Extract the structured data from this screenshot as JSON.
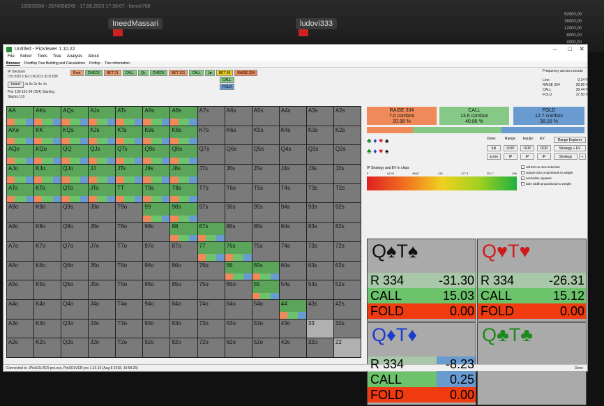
{
  "poker": {
    "topline": "1000/2000 - 2874358249 - 17.08.2020 17:30:07 - bench788",
    "players": [
      "IneedMassari",
      "ludovi333"
    ],
    "side_stacks": [
      "52000,00",
      "16000,00",
      "12000,00",
      "8000,00",
      "4000,00"
    ]
  },
  "window": {
    "title": "Untitled - PioViewer 1.10.22",
    "min": "–",
    "max": "□",
    "close": "✕"
  },
  "menu": [
    "File",
    "Solver",
    "Tools",
    "Tree",
    "Analysis",
    "About"
  ],
  "tabs": [
    "Browser",
    "Postflop Tree Building and Calculations",
    "Preflop",
    "Tree information"
  ],
  "left_info": {
    "heading": "IP Decision",
    "line1": "r:0:c:b21:c:Gc:c:b101:c:Jc:b:189",
    "board_btn": "board",
    "board_cards": "Js  6c  2s  4c  Jo",
    "pot": "Pot: 109 101 64 (354) Starting Stacks:110"
  },
  "actions": [
    {
      "label": "Root",
      "color": "#f0a070"
    },
    {
      "label": "CHECK",
      "color": "#86c986"
    },
    {
      "label": "BET 21",
      "color": "#f0a070"
    },
    {
      "label": "CALL",
      "color": "#86c986"
    },
    {
      "label": "Qc",
      "color": "#86c986"
    },
    {
      "label": "CHECK",
      "color": "#86c986"
    },
    {
      "label": "BET 101",
      "color": "#f0a070"
    },
    {
      "label": "CALL",
      "color": "#86c986"
    },
    {
      "label": "J♣",
      "color": "#86c986"
    },
    {
      "label": "BET 88",
      "color": "#f0d020"
    },
    {
      "label": "RAISE 334",
      "color": "#f08a5a"
    }
  ],
  "actions_sub": [
    "CALL",
    "FOLD"
  ],
  "freq": {
    "title": "Frequency across runouts",
    "rows": [
      [
        "Line:",
        "0.14 %"
      ],
      [
        "RAISE 334",
        "28.86 %"
      ],
      [
        "CALL",
        "38.44 %"
      ],
      [
        "FOLD",
        "37.50 %"
      ]
    ]
  },
  "grid": [
    [
      "AA",
      "AKs",
      "AQs",
      "AJs",
      "ATs",
      "A9s",
      "A8s",
      "A7s",
      "A6s",
      "A5s",
      "A4s",
      "A3s",
      "A2s"
    ],
    [
      "AKo",
      "KK",
      "KQs",
      "KJs",
      "KTs",
      "K9s",
      "K8s",
      "K7s",
      "K6s",
      "K5s",
      "K4s",
      "K3s",
      "K2s"
    ],
    [
      "AQo",
      "KQo",
      "QQ",
      "QJs",
      "QTs",
      "Q9s",
      "Q8s",
      "Q7s",
      "Q6s",
      "Q5s",
      "Q4s",
      "Q3s",
      "Q2s"
    ],
    [
      "AJo",
      "KJo",
      "QJo",
      "JJ",
      "JTs",
      "J9s",
      "J8s",
      "J7s",
      "J6s",
      "J5s",
      "J4s",
      "J3s",
      "J2s"
    ],
    [
      "ATo",
      "KTo",
      "QTo",
      "JTo",
      "TT",
      "T9s",
      "T8s",
      "T7s",
      "T6s",
      "T5s",
      "T4s",
      "T3s",
      "T2s"
    ],
    [
      "A9o",
      "K9o",
      "Q9o",
      "J9o",
      "T9o",
      "99",
      "98s",
      "97s",
      "96s",
      "95s",
      "94s",
      "93s",
      "92s"
    ],
    [
      "A8o",
      "K8o",
      "Q8o",
      "J8o",
      "T8o",
      "98o",
      "88",
      "87s",
      "86s",
      "85s",
      "84s",
      "83s",
      "82s"
    ],
    [
      "A7o",
      "K7o",
      "Q7o",
      "J7o",
      "T7o",
      "97o",
      "87o",
      "77",
      "76s",
      "75s",
      "74s",
      "73s",
      "72s"
    ],
    [
      "A6o",
      "K6o",
      "Q6o",
      "J6o",
      "T6o",
      "96o",
      "86o",
      "76o",
      "66",
      "65s",
      "64s",
      "63s",
      "62s"
    ],
    [
      "A5o",
      "K5o",
      "Q5o",
      "J5o",
      "T5o",
      "95o",
      "85o",
      "75o",
      "65o",
      "55",
      "54s",
      "53s",
      "52s"
    ],
    [
      "A4o",
      "K4o",
      "Q4o",
      "J4o",
      "T4o",
      "94o",
      "84o",
      "74o",
      "64o",
      "54o",
      "44",
      "43s",
      "42s"
    ],
    [
      "A3o",
      "K3o",
      "Q3o",
      "J3o",
      "T3o",
      "93o",
      "83o",
      "73o",
      "63o",
      "53o",
      "43o",
      "33",
      "32s"
    ],
    [
      "A2o",
      "K2o",
      "Q2o",
      "J2o",
      "T2o",
      "92o",
      "82o",
      "72o",
      "62o",
      "52o",
      "42o",
      "32o",
      "22"
    ]
  ],
  "summary": {
    "raise": {
      "name": "RAISE 334",
      "combos": "7.0 combos",
      "pct": "20.98 %"
    },
    "call": {
      "name": "CALL",
      "combos": "13.6 combos",
      "pct": "40.86 %"
    },
    "fold": {
      "name": "FOLD",
      "combos": "12.7 combos",
      "pct": "38.16 %"
    }
  },
  "controls": {
    "hdr": [
      "Done:",
      "Range:",
      "Equity:",
      "EV:"
    ],
    "row1": [
      "full",
      "OOP",
      "OOP",
      "OOP"
    ],
    "row2": [
      "score",
      "IP",
      "IP",
      "IP"
    ],
    "range_explorer": "Range Explorer",
    "strategy_ev": "Strategy + EV",
    "strategy": "Strategy",
    "lt": "<"
  },
  "ev": {
    "label": "IP Strategy and EV in chips",
    "ticks": [
      "0",
      "44.33",
      "88.67",
      "133",
      "177.3",
      "221.7",
      "266"
    ]
  },
  "checkboxes": [
    "refresh on new selection",
    "square size proportional to weight",
    "normalize squares",
    "bars width proportional to weight"
  ],
  "hands": [
    {
      "title": "Q♠T♠",
      "suit_color": "#111",
      "r": "-31.30",
      "c": "15.03",
      "f": "0.00",
      "rl": "R 334",
      "cl": "CALL",
      "fl": "FOLD"
    },
    {
      "title": "Q♥T♥",
      "suit_color": "#d01a1a",
      "r": "-26.31",
      "c": "15.12",
      "f": "0.00",
      "rl": "R 334",
      "cl": "CALL",
      "fl": "FOLD"
    },
    {
      "title": "Q♦T♦",
      "suit_color": "#1a3ad0",
      "r": "-8.23",
      "c": "0.25",
      "f": "0.00",
      "rl": "R 334",
      "cl": "CALL",
      "fl": "FOLD"
    },
    {
      "title": "Q♣T♣",
      "suit_color": "#1a8a1a",
      "r": "",
      "c": "",
      "f": "",
      "rl": "",
      "cl": "",
      "fl": ""
    }
  ],
  "status": {
    "text": "Connected to .\\PioSOLVER-pro.exe, PioSOLVER-pro 1.10.19 (Aug  8 2018, 10:58:25)",
    "done": "Done"
  }
}
